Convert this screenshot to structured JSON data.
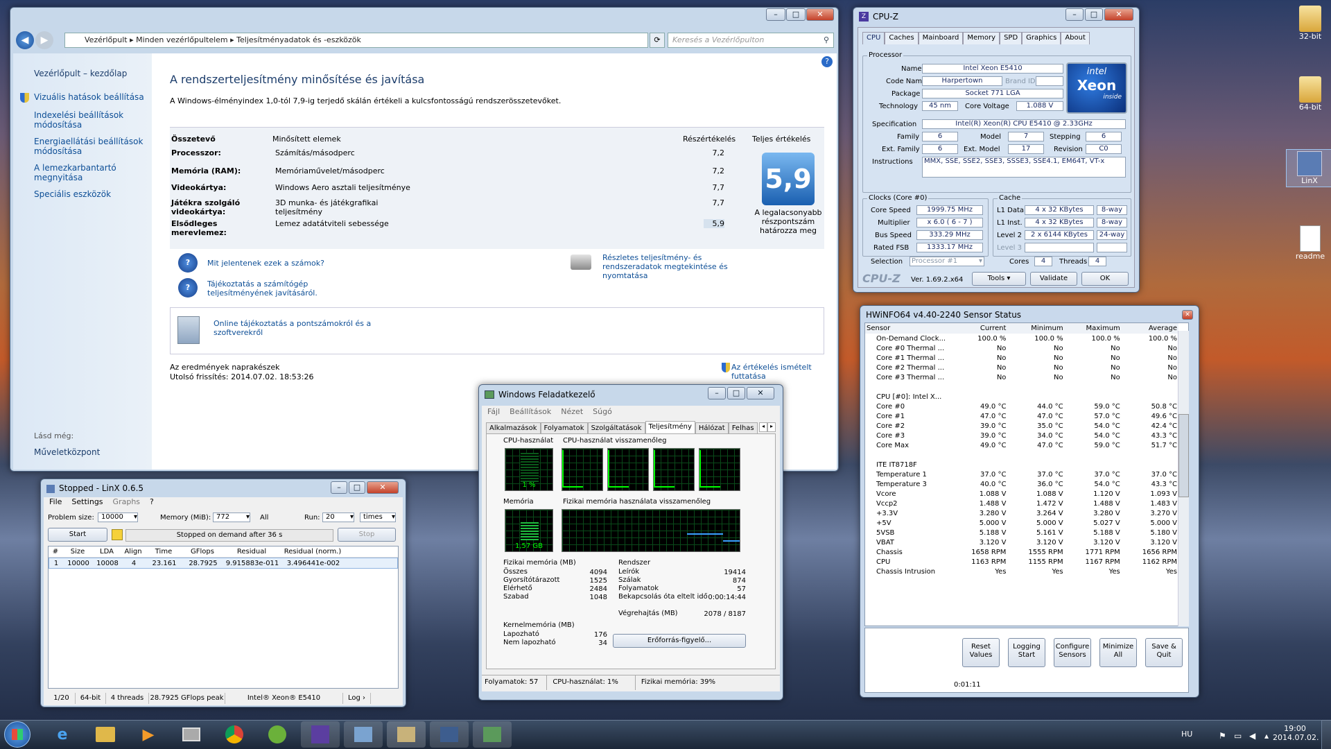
{
  "desktop": {
    "icons": [
      {
        "label": "32-bit"
      },
      {
        "label": "64-bit"
      },
      {
        "label": "LinX"
      },
      {
        "label": "readme"
      }
    ]
  },
  "cp": {
    "breadcrumb": [
      "Vezérlőpult",
      "Minden vezérlőpultelem",
      "Teljesítményadatok és -eszközök"
    ],
    "search_placeholder": "Keresés a Vezérlőpulton",
    "sidebar": {
      "home": "Vezérlőpult – kezdőlap",
      "items": [
        "Vizuális hatások beállítása",
        "Indexelési beállítások módosítása",
        "Energiaellátási beállítások módosítása",
        "A lemezkarbantartó megnyitása",
        "Speciális eszközök"
      ],
      "see_also": "Lásd még:",
      "see_also_item": "Műveletközpont"
    },
    "title": "A rendszerteljesítmény minősítése és javítása",
    "desc": "A Windows-élményindex 1,0-tól 7,9-ig terjedő skálán értékeli a kulcsfontosságú rendszerösszetevőket.",
    "headers": [
      "Összetevő",
      "Minősített elemek",
      "Részértékelés",
      "Teljes értékelés"
    ],
    "rows": [
      {
        "c": "Processzor:",
        "d": "Számítás/másodperc",
        "s": "7,2"
      },
      {
        "c": "Memória (RAM):",
        "d": "Memóriaművelet/másodperc",
        "s": "7,2"
      },
      {
        "c": "Videokártya:",
        "d": "Windows Aero asztali teljesítménye",
        "s": "7,7"
      },
      {
        "c": "Játékra szolgáló videokártya:",
        "d": "3D munka- és játékgrafikai teljesítmény",
        "s": "7,7"
      },
      {
        "c": "Elsődleges merevlemez:",
        "d": "Lemez adatátviteli sebessége",
        "s": "5,9"
      }
    ],
    "total": "5,9",
    "total_note": "A legalacsonyabb részpontszám határozza meg",
    "links": [
      "Mit jelentenek ezek a számok?",
      "Tájékoztatás a számítógép teljesítményének javításáról.",
      "Részletes teljesítmény- és rendszeradatok megtekintése és nyomtatása",
      "Online tájékoztatás a pontszámokról és a szoftverekről"
    ],
    "status1": "Az eredmények naprakészek",
    "status2": "Utolsó frissítés: 2014.07.02. 18:53:26",
    "rerun": "Az értékelés ismételt futtatása"
  },
  "cpuz": {
    "title": "CPU-Z",
    "tabs": [
      "CPU",
      "Caches",
      "Mainboard",
      "Memory",
      "SPD",
      "Graphics",
      "About"
    ],
    "proc_label": "Processor",
    "name_l": "Name",
    "name": "Intel Xeon E5410",
    "code_l": "Code Name",
    "code": "Harpertown",
    "brand": "Brand ID",
    "pkg_l": "Package",
    "pkg": "Socket 771 LGA",
    "tech_l": "Technology",
    "tech": "45 nm",
    "volt_l": "Core Voltage",
    "volt": "1.088 V",
    "spec_l": "Specification",
    "spec": "Intel(R) Xeon(R) CPU        E5410  @ 2.33GHz",
    "fam_l": "Family",
    "fam": "6",
    "model_l": "Model",
    "model": "7",
    "step_l": "Stepping",
    "step": "6",
    "efam_l": "Ext. Family",
    "efam": "6",
    "emod_l": "Ext. Model",
    "emod": "17",
    "rev_l": "Revision",
    "rev": "C0",
    "instr_l": "Instructions",
    "instr": "MMX, SSE, SSE2, SSE3, SSSE3, SSE4.1, EM64T, VT-x",
    "clocks_label": "Clocks (Core #0)",
    "cs_l": "Core Speed",
    "cs": "1999.75 MHz",
    "mul_l": "Multiplier",
    "mul": "x 6.0 ( 6 - 7 )",
    "bus_l": "Bus Speed",
    "bus": "333.29 MHz",
    "fsb_l": "Rated FSB",
    "fsb": "1333.17 MHz",
    "cache_label": "Cache",
    "l1d_l": "L1 Data",
    "l1d": "4 x 32 KBytes",
    "l1d_w": "8-way",
    "l1i_l": "L1 Inst.",
    "l1i": "4 x 32 KBytes",
    "l1i_w": "8-way",
    "l2_l": "Level 2",
    "l2": "2 x 6144 KBytes",
    "l2_w": "24-way",
    "l3_l": "Level 3",
    "sel_l": "Selection",
    "sel": "Processor #1",
    "cores_l": "Cores",
    "cores": "4",
    "thr_l": "Threads",
    "thr": "4",
    "logo": "CPU-Z",
    "ver": "Ver. 1.69.2.x64",
    "tools": "Tools",
    "validate": "Validate",
    "ok": "OK",
    "badge": {
      "brand": "intel",
      "product": "Xeon",
      "tag": "inside"
    }
  },
  "hw": {
    "title": "HWiNFO64 v4.40-2240 Sensor Status",
    "cols": [
      "Sensor",
      "Current",
      "Minimum",
      "Maximum",
      "Average"
    ],
    "rows": [
      [
        "On-Demand Clock...",
        "100.0 %",
        "100.0 %",
        "100.0 %",
        "100.0 %"
      ],
      [
        "Core #0 Thermal ...",
        "No",
        "No",
        "No",
        "No"
      ],
      [
        "Core #1 Thermal ...",
        "No",
        "No",
        "No",
        "No"
      ],
      [
        "Core #2 Thermal ...",
        "No",
        "No",
        "No",
        "No"
      ],
      [
        "Core #3 Thermal ...",
        "No",
        "No",
        "No",
        "No"
      ],
      [
        "",
        "",
        "",
        "",
        ""
      ],
      [
        "CPU [#0]: Intel X...",
        "",
        "",
        "",
        ""
      ],
      [
        "Core #0",
        "49.0 °C",
        "44.0 °C",
        "59.0 °C",
        "50.8 °C"
      ],
      [
        "Core #1",
        "47.0 °C",
        "47.0 °C",
        "57.0 °C",
        "49.6 °C"
      ],
      [
        "Core #2",
        "39.0 °C",
        "35.0 °C",
        "54.0 °C",
        "42.4 °C"
      ],
      [
        "Core #3",
        "39.0 °C",
        "34.0 °C",
        "54.0 °C",
        "43.3 °C"
      ],
      [
        "Core Max",
        "49.0 °C",
        "47.0 °C",
        "59.0 °C",
        "51.7 °C"
      ],
      [
        "",
        "",
        "",
        "",
        ""
      ],
      [
        "ITE IT8718F",
        "",
        "",
        "",
        ""
      ],
      [
        "Temperature 1",
        "37.0 °C",
        "37.0 °C",
        "37.0 °C",
        "37.0 °C"
      ],
      [
        "Temperature 3",
        "40.0 °C",
        "36.0 °C",
        "54.0 °C",
        "43.3 °C"
      ],
      [
        "Vcore",
        "1.088 V",
        "1.088 V",
        "1.120 V",
        "1.093 V"
      ],
      [
        "Vccp2",
        "1.488 V",
        "1.472 V",
        "1.488 V",
        "1.483 V"
      ],
      [
        "+3.3V",
        "3.280 V",
        "3.264 V",
        "3.280 V",
        "3.270 V"
      ],
      [
        "+5V",
        "5.000 V",
        "5.000 V",
        "5.027 V",
        "5.000 V"
      ],
      [
        "5VSB",
        "5.188 V",
        "5.161 V",
        "5.188 V",
        "5.180 V"
      ],
      [
        "VBAT",
        "3.120 V",
        "3.120 V",
        "3.120 V",
        "3.120 V"
      ],
      [
        "Chassis",
        "1658 RPM",
        "1555 RPM",
        "1771 RPM",
        "1656 RPM"
      ],
      [
        "CPU",
        "1163 RPM",
        "1155 RPM",
        "1167 RPM",
        "1162 RPM"
      ],
      [
        "Chassis Intrusion",
        "Yes",
        "Yes",
        "Yes",
        "Yes"
      ]
    ],
    "buttons": [
      "Reset Values",
      "Logging Start",
      "Configure Sensors",
      "Minimize All",
      "Save & Quit"
    ],
    "timer": "0:01:11"
  },
  "tm": {
    "title": "Windows Feladatkezelő",
    "menu": [
      "Fájl",
      "Beállítások",
      "Nézet",
      "Súgó"
    ],
    "tabs": [
      "Alkalmazások",
      "Folyamatok",
      "Szolgáltatások",
      "Teljesítmény",
      "Hálózat",
      "Felhas"
    ],
    "cpu_use": "CPU-használat",
    "cpu_hist": "CPU-használat visszamenőleg",
    "cpu_val": "1 %",
    "mem": "Memória",
    "mem_hist": "Fizikai memória használata visszamenőleg",
    "mem_val": "1,57 GB",
    "phys_title": "Fizikai memória (MB)",
    "phys": [
      [
        "Összes",
        "4094"
      ],
      [
        "Gyorsítótárazott",
        "1525"
      ],
      [
        "Elérhető",
        "2484"
      ],
      [
        "Szabad",
        "1048"
      ]
    ],
    "kern_title": "Kernelmemória (MB)",
    "kern": [
      [
        "Lapozható",
        "176"
      ],
      [
        "Nem lapozható",
        "34"
      ]
    ],
    "sys_title": "Rendszer",
    "sys": [
      [
        "Leírók",
        "19414"
      ],
      [
        "Szálak",
        "874"
      ],
      [
        "Folyamatok",
        "57"
      ],
      [
        "Bekapcsolás óta eltelt idő",
        "0:00:14:44"
      ],
      [
        "Végrehajtás (MB)",
        "2078 / 8187"
      ]
    ],
    "monitor": "Erőforrás-figyelő...",
    "status": [
      "Folyamatok: 57",
      "CPU-használat: 1%",
      "Fizikai memória: 39%"
    ],
    "cpu_pct": 0.01,
    "mem_pct": 0.39
  },
  "linx": {
    "title": "Stopped - LinX 0.6.5",
    "menu": [
      "File",
      "Settings",
      "Graphs",
      "?"
    ],
    "ps_l": "Problem size:",
    "ps": "10000",
    "mem_l": "Memory (MiB):",
    "mem": "772",
    "all": "All",
    "run_l": "Run:",
    "run": "20",
    "times": "times",
    "start": "Start",
    "stop": "Stop",
    "msg": "Stopped on demand after 36 s",
    "cols": [
      "#",
      "Size",
      "LDA",
      "Align",
      "Time",
      "GFlops",
      "Residual",
      "Residual (norm.)"
    ],
    "rows": [
      [
        "1",
        "10000",
        "10008",
        "4",
        "23.161",
        "28.7925",
        "9.915883e-011",
        "3.496441e-002"
      ]
    ],
    "status": [
      "1/20",
      "64-bit",
      "4 threads",
      "28.7925 GFlops peak",
      "Intel® Xeon® E5410",
      "Log ›"
    ]
  },
  "taskbar": {
    "lang": "HU",
    "time": "19:00",
    "date": "2014.07.02."
  }
}
